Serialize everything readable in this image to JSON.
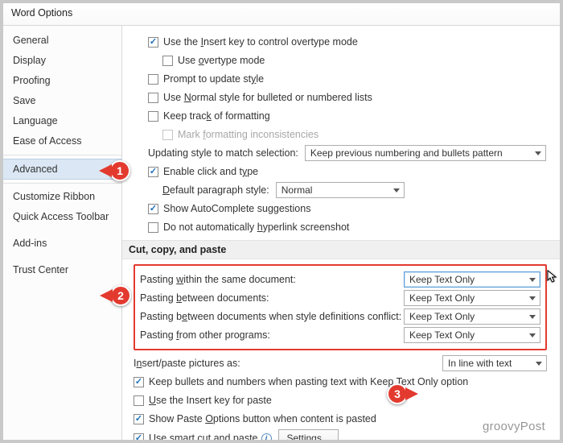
{
  "window": {
    "title": "Word Options"
  },
  "sidebar": {
    "items": [
      {
        "label": "General",
        "selected": false
      },
      {
        "label": "Display",
        "selected": false
      },
      {
        "label": "Proofing",
        "selected": false
      },
      {
        "label": "Save",
        "selected": false
      },
      {
        "label": "Language",
        "selected": false
      },
      {
        "label": "Ease of Access",
        "selected": false
      },
      {
        "label": "Advanced",
        "selected": true
      },
      {
        "label": "Customize Ribbon",
        "selected": false
      },
      {
        "label": "Quick Access Toolbar",
        "selected": false
      },
      {
        "label": "Add-ins",
        "selected": false
      },
      {
        "label": "Trust Center",
        "selected": false
      }
    ]
  },
  "editing": {
    "insert_key_overtype": {
      "pre": "Use the ",
      "u": "I",
      "post": "nsert key to control overtype mode",
      "checked": true
    },
    "use_overtype": {
      "pre": "Use ",
      "u": "o",
      "post": "vertype mode",
      "checked": false
    },
    "prompt_update_style": {
      "pre": "Prompt to update st",
      "u": "y",
      "post": "le",
      "checked": false
    },
    "normal_bulleted": {
      "pre": "Use ",
      "u": "N",
      "post": "ormal style for bulleted or numbered lists",
      "checked": false
    },
    "keep_track_fmt": {
      "pre": "Keep trac",
      "u": "k",
      "post": " of formatting",
      "checked": false
    },
    "mark_inconsistencies": {
      "pre": "Mark ",
      "u": "f",
      "post": "ormatting inconsistencies",
      "checked": false,
      "disabled": true
    },
    "updating_style_label": "Updating style to match selection:",
    "updating_style_value": "Keep previous numbering and bullets pattern",
    "enable_click_type": {
      "pre": "Enable click and t",
      "u": "y",
      "post": "pe",
      "checked": true
    },
    "default_para_label": {
      "pre": "",
      "u": "D",
      "post": "efault paragraph style:"
    },
    "default_para_value": "Normal",
    "show_autocomplete": {
      "text": "Show AutoComplete suggestions",
      "checked": true
    },
    "no_auto_hyperlink": {
      "pre": "Do not automatically ",
      "u": "h",
      "post": "yperlink screenshot",
      "checked": false
    }
  },
  "paste": {
    "section_title": "Cut, copy, and paste",
    "rows": [
      {
        "label_pre": "Pasting ",
        "label_u": "w",
        "label_post": "ithin the same document:",
        "value": "Keep Text Only"
      },
      {
        "label_pre": "Pasting ",
        "label_u": "b",
        "label_post": "etween documents:",
        "value": "Keep Text Only"
      },
      {
        "label_pre": "Pasting b",
        "label_u": "e",
        "label_post": "tween documents when style definitions conflict:",
        "value": "Keep Text Only"
      },
      {
        "label_pre": "Pasting ",
        "label_u": "f",
        "label_post": "rom other programs:",
        "value": "Keep Text Only"
      }
    ],
    "insert_pictures_label": {
      "pre": "I",
      "u": "n",
      "post": "sert/paste pictures as:"
    },
    "insert_pictures_value": "In line with text",
    "keep_bullets": {
      "text": "Keep bullets and numbers when pasting text with Keep Text Only option",
      "checked": true
    },
    "use_insert_key_paste": {
      "pre": "",
      "u": "U",
      "post": "se the Insert key for paste",
      "checked": false
    },
    "show_paste_options": {
      "pre": "Show Paste ",
      "u": "O",
      "post": "ptions button when content is pasted",
      "checked": true
    },
    "smart_cut_paste": {
      "pre": "Use s",
      "u": "m",
      "post": "art cut and paste",
      "checked": true
    },
    "settings_btn": "Settings..."
  },
  "callouts": {
    "c1": "1",
    "c2": "2",
    "c3": "3"
  },
  "watermark": "groovyPost"
}
